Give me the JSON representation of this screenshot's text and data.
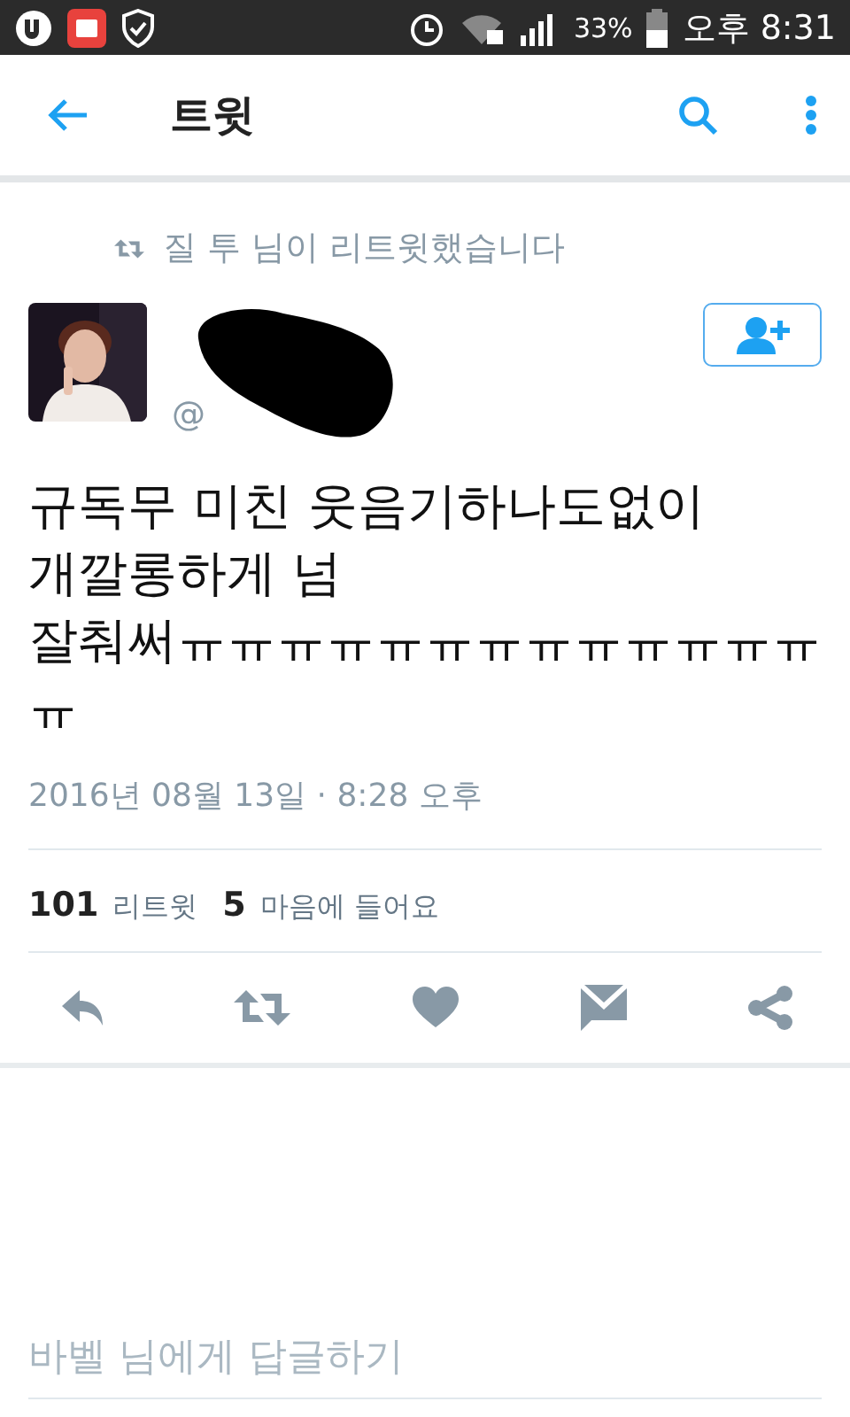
{
  "status_bar": {
    "battery_percent": "33%",
    "time": "오후 8:31"
  },
  "toolbar": {
    "title": "트윗"
  },
  "retweeted_by": "질 투 님이 리트윗했습니다",
  "tweet": {
    "handle": "@",
    "text_lines": [
      "규독무 미친 웃음기하나도없이",
      "개깔롱하게 넘",
      "잘춰써ㅠㅠㅠㅠㅠㅠㅠㅠㅠㅠㅠㅠㅠ",
      "ㅠ"
    ],
    "date": "2016년 08월 13일 · 8:28 오후"
  },
  "stats": [
    {
      "count": "101",
      "label": "리트윗"
    },
    {
      "count": "5",
      "label": "마음에 들어요"
    }
  ],
  "actions": [
    {
      "kind": "reply"
    },
    {
      "kind": "retweet"
    },
    {
      "kind": "like"
    },
    {
      "kind": "message"
    },
    {
      "kind": "share"
    }
  ],
  "reply_field": {
    "placeholder": "바벨 님에게 답글하기"
  }
}
